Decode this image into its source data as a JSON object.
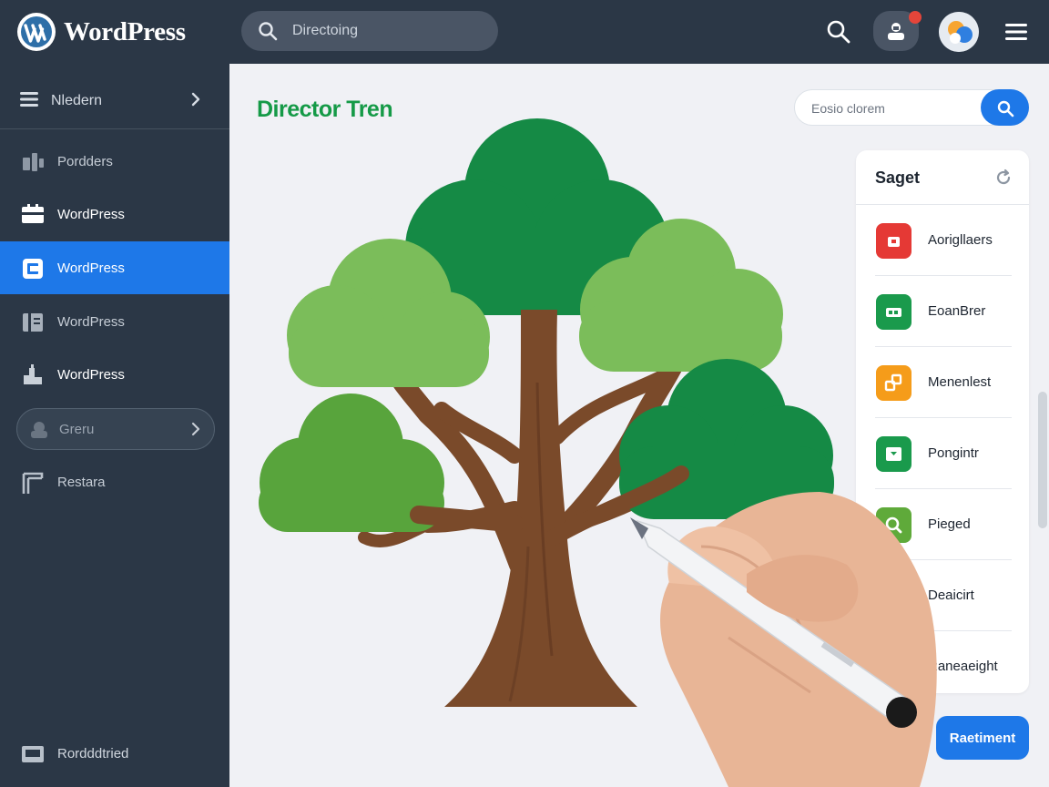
{
  "app": {
    "brand": "WordPress"
  },
  "topbar": {
    "search_placeholder": "Directoing",
    "icons": [
      "search-icon",
      "user-lock-icon",
      "notification-dot",
      "avatar",
      "hamburger-menu-icon"
    ]
  },
  "sidebar": {
    "header_label": "Nledern",
    "items": [
      {
        "label": "Pordders",
        "icon": "plugin-icon"
      },
      {
        "label": "WordPress",
        "icon": "layout-icon"
      },
      {
        "label": "WordPress",
        "icon": "media-icon",
        "active": true
      },
      {
        "label": "WordPress",
        "icon": "pages-icon"
      },
      {
        "label": "WordPress",
        "icon": "appearance-icon"
      }
    ],
    "pill_label": "Greru",
    "extra_label": "Restara",
    "footer_label": "Rordddtried"
  },
  "main": {
    "title": "Director Tren",
    "filter_placeholder": "Eosio clorem"
  },
  "panel": {
    "title": "Saget",
    "items": [
      {
        "label": "Aorigllaers",
        "color": "#e53935"
      },
      {
        "label": "EoanBrer",
        "color": "#1a9a4c"
      },
      {
        "label": "Menenlest",
        "color": "#f59c1a"
      },
      {
        "label": "Pongintr",
        "color": "#1a9a4c"
      },
      {
        "label": "Pieged",
        "color": "#5faa3a"
      },
      {
        "label": "Deaicirt",
        "color": "#f59c1a"
      },
      {
        "label": "Raneaeight",
        "color": "#d4a020"
      }
    ]
  },
  "actions": {
    "save_label": "Raetiment"
  },
  "colors": {
    "accent": "#1e78e8",
    "sidebar": "#2b3746",
    "title_green": "#159a47"
  }
}
